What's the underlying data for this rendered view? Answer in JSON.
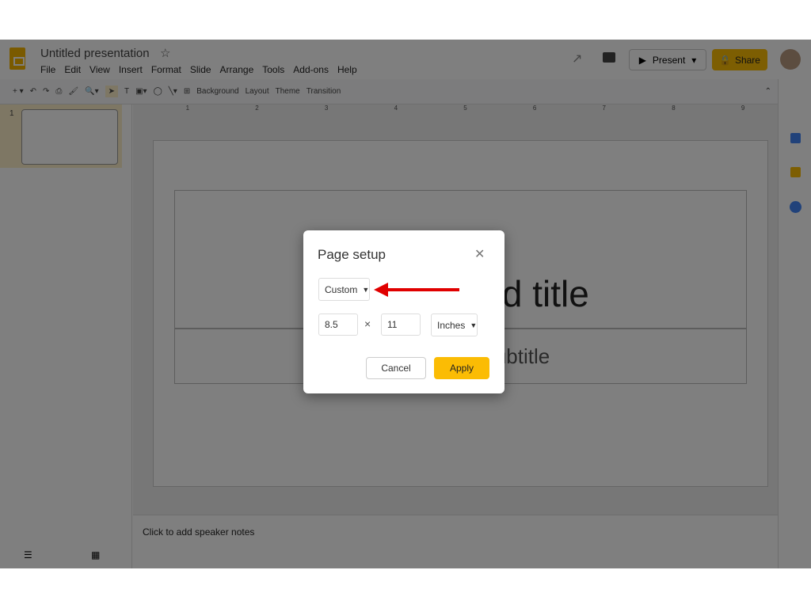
{
  "header": {
    "title": "Untitled presentation",
    "menu": [
      "File",
      "Edit",
      "View",
      "Insert",
      "Format",
      "Slide",
      "Arrange",
      "Tools",
      "Add-ons",
      "Help"
    ],
    "present_label": "Present",
    "share_label": "Share"
  },
  "toolbar": {
    "background": "Background",
    "layout": "Layout",
    "theme": "Theme",
    "transition": "Transition"
  },
  "ruler": [
    "1",
    "2",
    "3",
    "4",
    "5",
    "6",
    "7",
    "8",
    "9"
  ],
  "slides": {
    "number": "1"
  },
  "slide": {
    "title": "Click to add title",
    "subtitle": "Click to add subtitle"
  },
  "notes": {
    "placeholder": "Click to add speaker notes"
  },
  "dialog": {
    "title": "Page setup",
    "preset": "Custom",
    "width": "8.5",
    "times": "×",
    "height": "11",
    "unit": "Inches",
    "cancel": "Cancel",
    "apply": "Apply"
  },
  "colors": {
    "accent": "#fbbc04",
    "arrow": "#e00000"
  }
}
